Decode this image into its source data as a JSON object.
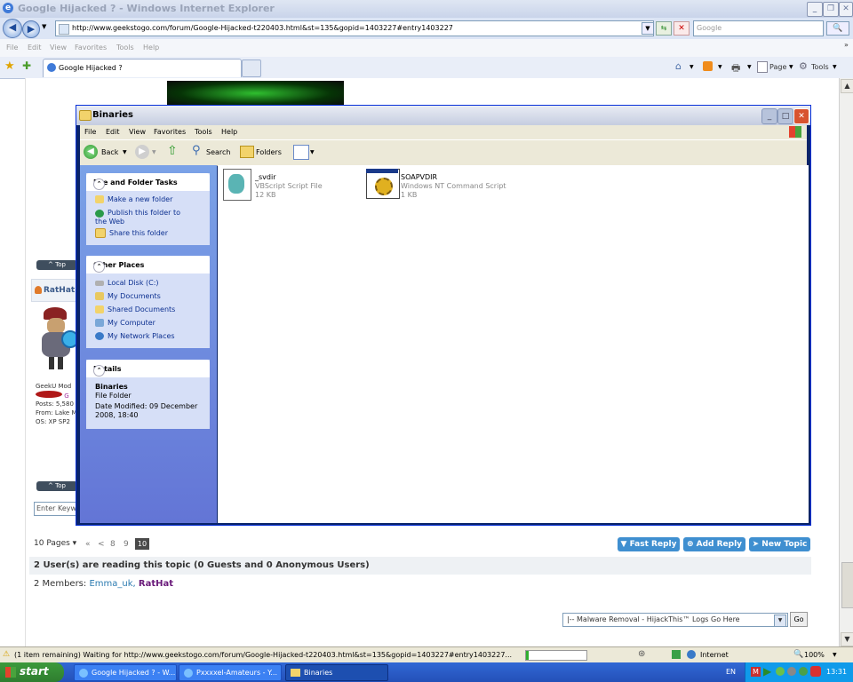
{
  "ie": {
    "title": "Google Hijacked ? - Windows Internet Explorer",
    "address": "http://www.geekstogo.com/forum/Google-Hijacked-t220403.html&st=135&gopid=1403227#entry1403227",
    "search_placeholder": "Google",
    "menu": [
      "File",
      "Edit",
      "View",
      "Favorites",
      "Tools",
      "Help"
    ],
    "tab_label": "Google Hijacked ?",
    "toolbar_page": "Page",
    "toolbar_tools": "Tools"
  },
  "forum": {
    "top_label": "^ Top",
    "user_name": "RatHat",
    "user_info": [
      "GeekU Mod",
      "Posts: 5,580",
      "From: Lake M",
      "OS: XP SP2"
    ],
    "search_placeholder": "Enter Keyw",
    "pages_label": "10 Pages",
    "pages": [
      "«",
      "<",
      "8",
      "9",
      "10"
    ],
    "current_page": "10",
    "buttons": {
      "fast_reply": "Fast Reply",
      "add_reply": "Add Reply",
      "new_topic": "New Topic"
    },
    "reading": "2 User(s) are reading this topic (0 Guests and 0 Anonymous Users)",
    "members_label": "2 Members:",
    "member_1": "Emma_uk,",
    "member_2": "RatHat",
    "jump_select": "|-- Malware Removal - HijackThis™ Logs Go Here",
    "go_label": "Go"
  },
  "explorer": {
    "title": "Binaries",
    "menu": [
      "File",
      "Edit",
      "View",
      "Favorites",
      "Tools",
      "Help"
    ],
    "toolbar": {
      "back": "Back",
      "search": "Search",
      "folders": "Folders"
    },
    "tasks": {
      "title": "File and Folder Tasks",
      "items": [
        "Make a new folder",
        "Publish this folder to the Web",
        "Share this folder"
      ]
    },
    "other": {
      "title": "Other Places",
      "items": [
        "Local Disk (C:)",
        "My Documents",
        "Shared Documents",
        "My Computer",
        "My Network Places"
      ]
    },
    "details": {
      "title": "Details",
      "name": "Binaries",
      "type": "File Folder",
      "modified": "Date Modified: 09 December 2008, 18:40"
    },
    "files": [
      {
        "name": "_svdir",
        "type": "VBScript Script File",
        "size": "12 KB"
      },
      {
        "name": "SOAPVDIR",
        "type": "Windows NT Command Script",
        "size": "1 KB"
      }
    ]
  },
  "status": {
    "text": "(1 item remaining) Waiting for http://www.geekstogo.com/forum/Google-Hijacked-t220403.html&st=135&gopid=1403227#entry1403227...",
    "zone": "Internet",
    "zoom": "100%"
  },
  "taskbar": {
    "start": "start",
    "tasks": [
      "Google Hijacked ? - W...",
      "Pxxxxel-Amateurs - Y...",
      "Binaries"
    ],
    "lang": "EN",
    "clock": "13:31"
  }
}
